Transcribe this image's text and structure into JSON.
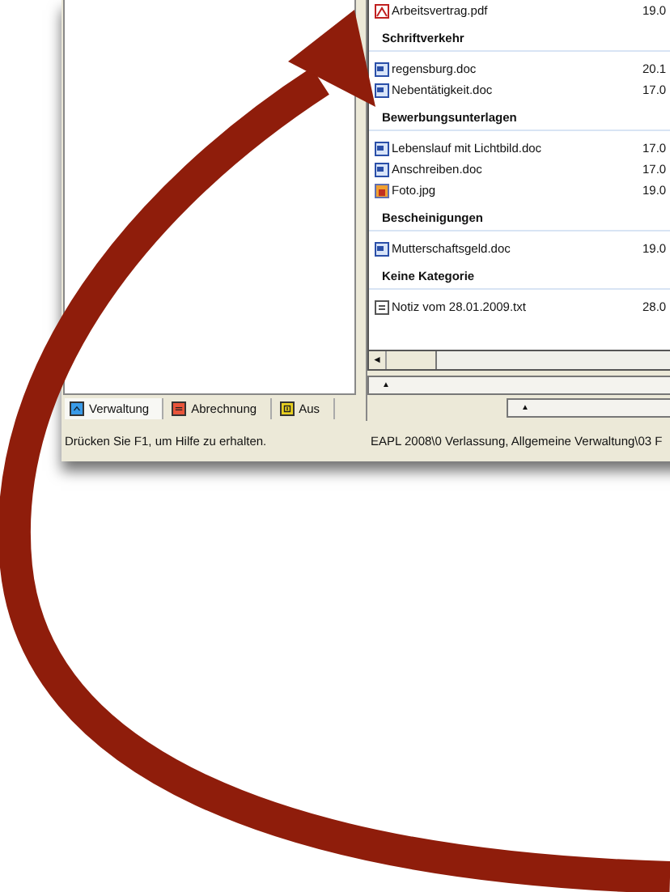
{
  "left_panel": {
    "tabs": [
      {
        "label": "Verwaltung",
        "selected": true,
        "kind": "up",
        "color": "#3a9be8"
      },
      {
        "label": "Abrechnung",
        "selected": false,
        "kind": "lines",
        "color": "#e8543a"
      },
      {
        "label": "Aus",
        "selected": false,
        "kind": "number",
        "color": "#e8d020"
      }
    ],
    "status_bar": "Drücken Sie F1, um Hilfe zu erhalten."
  },
  "file_list": {
    "top_file": {
      "name": "Arbeitsvertrag.pdf",
      "date": "19.0",
      "kind": "pdf"
    },
    "sections": [
      {
        "heading": "Schriftverkehr",
        "files": [
          {
            "name": "regensburg.doc",
            "date": "20.1",
            "kind": "doc"
          },
          {
            "name": "Nebentätigkeit.doc",
            "date": "17.0",
            "kind": "doc"
          }
        ]
      },
      {
        "heading": "Bewerbungsunterlagen",
        "files": [
          {
            "name": "Lebenslauf mit Lichtbild.doc",
            "date": "17.0",
            "kind": "doc"
          },
          {
            "name": "Anschreiben.doc",
            "date": "17.0",
            "kind": "doc"
          },
          {
            "name": "Foto.jpg",
            "date": "19.0",
            "kind": "jpg"
          }
        ]
      },
      {
        "heading": "Bescheinigungen",
        "files": [
          {
            "name": "Mutterschaftsgeld.doc",
            "date": "19.0",
            "kind": "doc"
          }
        ]
      },
      {
        "heading": "Keine Kategorie",
        "files": [
          {
            "name": "Notiz vom 28.01.2009.txt",
            "date": "28.0",
            "kind": "txt"
          }
        ]
      }
    ],
    "scroll_left": "◄",
    "expand_button": "▲"
  },
  "lower_expand_button": "▲",
  "path": "EAPL 2008\\0 Verlassung, Allgemeine Verwaltung\\03 F"
}
